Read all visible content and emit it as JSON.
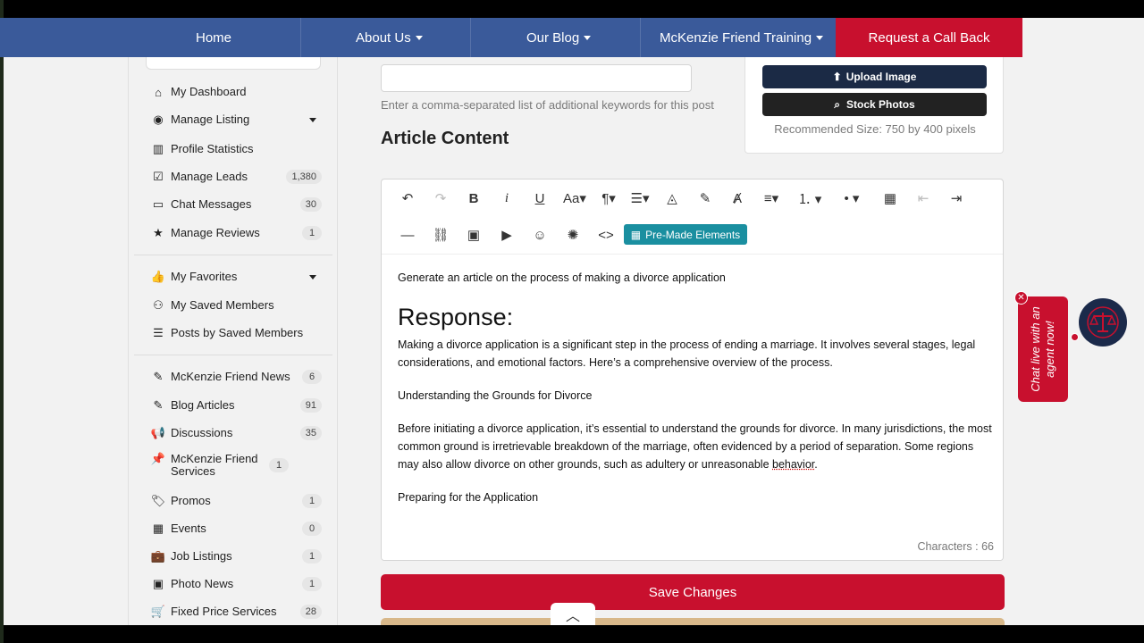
{
  "nav": {
    "items": [
      {
        "label": "Home",
        "has_dropdown": false
      },
      {
        "label": "About Us",
        "has_dropdown": true
      },
      {
        "label": "Our Blog",
        "has_dropdown": true
      },
      {
        "label": "McKenzie Friend Training",
        "has_dropdown": true
      }
    ],
    "cta": "Request a Call Back"
  },
  "sidebar": {
    "items": [
      {
        "label": "My Dashboard",
        "icon": "home-icon",
        "glyph": "⌂",
        "count": ""
      },
      {
        "label": "Manage Listing",
        "icon": "user-circle-icon",
        "glyph": "◉",
        "count": "",
        "dropdown": true
      },
      {
        "label": "Profile Statistics",
        "icon": "bar-chart-icon",
        "glyph": "▥",
        "count": ""
      },
      {
        "label": "Manage Leads",
        "icon": "checkbox-icon",
        "glyph": "☑",
        "count": "1,380"
      },
      {
        "label": "Chat Messages",
        "icon": "chat-icon",
        "glyph": "▭",
        "count": "30"
      },
      {
        "label": "Manage Reviews",
        "icon": "star-icon",
        "glyph": "★",
        "count": "1"
      },
      {
        "label": "My Favorites",
        "icon": "thumbs-up-icon",
        "glyph": "👍",
        "count": "",
        "dropdown": true
      },
      {
        "label": "My Saved Members",
        "icon": "user-plus-icon",
        "glyph": "⚇",
        "count": ""
      },
      {
        "label": "Posts by Saved Members",
        "icon": "list-icon",
        "glyph": "☰",
        "count": ""
      },
      {
        "label": "McKenzie Friend News",
        "icon": "pencil-icon",
        "glyph": "✎",
        "count": "6"
      },
      {
        "label": "Blog Articles",
        "icon": "pencil-icon",
        "glyph": "✎",
        "count": "91"
      },
      {
        "label": "Discussions",
        "icon": "megaphone-icon",
        "glyph": "📢",
        "count": "35"
      },
      {
        "label": "McKenzie Friend Services",
        "icon": "pin-icon",
        "glyph": "📌",
        "count": "1"
      },
      {
        "label": "Promos",
        "icon": "tag-icon",
        "glyph": "🏷",
        "count": "1"
      },
      {
        "label": "Events",
        "icon": "calendar-icon",
        "glyph": "▦",
        "count": "0"
      },
      {
        "label": "Job Listings",
        "icon": "briefcase-icon",
        "glyph": "💼",
        "count": "1"
      },
      {
        "label": "Photo News",
        "icon": "image-icon",
        "glyph": "▣",
        "count": "1"
      },
      {
        "label": "Fixed Price Services",
        "icon": "cart-icon",
        "glyph": "🛒",
        "count": "28"
      }
    ]
  },
  "main": {
    "tags_help": "Enter a comma-separated list of additional keywords for this post",
    "article_heading": "Article Content",
    "upload_image": "Upload Image",
    "stock_photos": "Stock Photos",
    "recommended_size": "Recommended Size: 750 by 400 pixels",
    "premade_elements": "Pre-Made Elements",
    "characters": "Characters : 66",
    "save_changes": "Save Changes"
  },
  "editor": {
    "prompt": "Generate an article on the process of making a divorce application",
    "response_heading": "Response:",
    "p1": "Making a divorce application is a significant step in the process of ending a marriage. It involves several stages, legal considerations, and emotional factors. Here’s a comprehensive overview of the process.",
    "h_grounds": "Understanding the Grounds for Divorce",
    "p2_before": "Before initiating a divorce application, it’s essential to understand the grounds for divorce. In many jurisdictions, the most common ground is irretrievable breakdown of the marriage, often evidenced by a period of separation. Some regions may also allow divorce on other grounds, such as adultery or unreasonable ",
    "p2_word": "behavior",
    "p2_after": ".",
    "h_preparing": "Preparing for the Application"
  },
  "chat": {
    "text": "Chat live with an agent now!"
  },
  "colors": {
    "nav": "#3a5a9a",
    "accent_red": "#c8102e",
    "dark_navy": "#1b2a45",
    "teal": "#1a8fa0"
  }
}
